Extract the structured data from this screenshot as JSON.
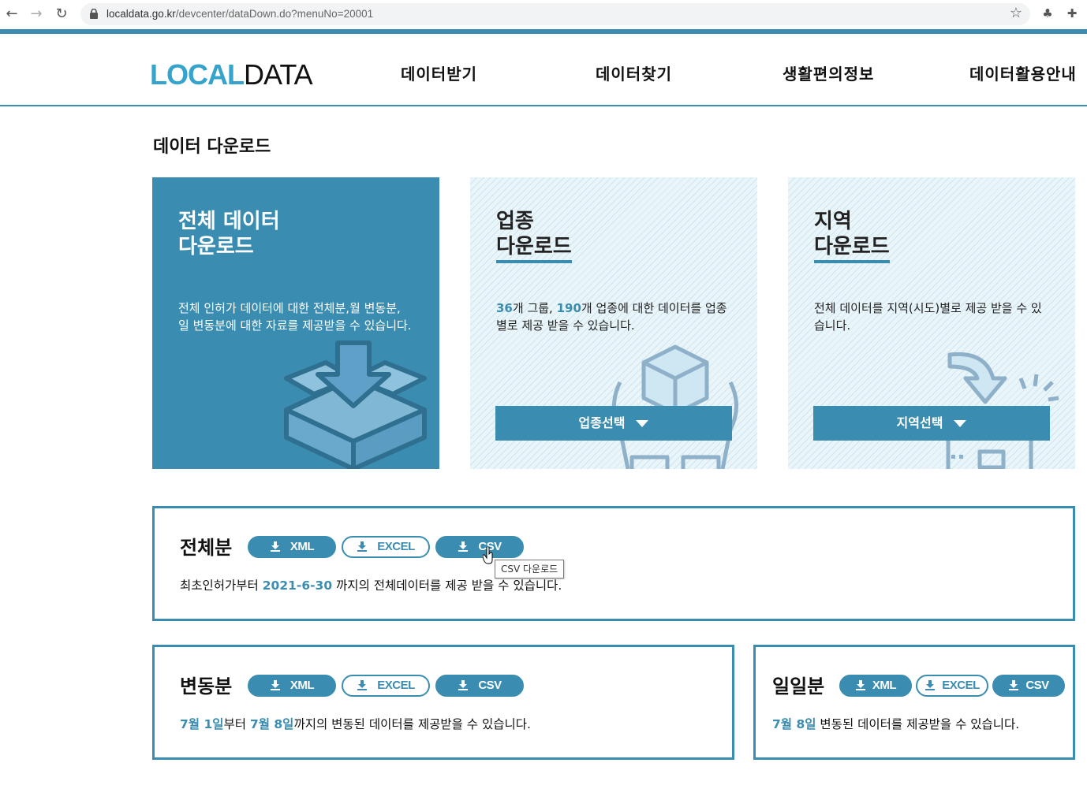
{
  "browser": {
    "url_host": "localdata.go.kr",
    "url_path": "/devcenter/dataDown.do?menuNo=20001"
  },
  "header": {
    "logo_part1": "LOCAL",
    "logo_part2": "DATA",
    "menu": [
      "데이터받기",
      "데이터찾기",
      "생활편의정보",
      "데이터활용안내"
    ]
  },
  "page_title": "데이터 다운로드",
  "cards": {
    "all": {
      "title_line1": "전체 데이터",
      "title_line2": "다운로드",
      "desc": "전체 인허가 데이터에 대한 전체분,월 변동분, 일 변동분에 대한 자료를 제공받을 수 있습니다."
    },
    "industry": {
      "title_line1": "업종",
      "title_line2": "다운로드",
      "group_count": "36",
      "group_text": "개 그룹, ",
      "industry_count": "190",
      "desc_rest": "개 업종에 대한 데이터를 업종별로 제공 받을 수 있습니다.",
      "button": "업종선택"
    },
    "region": {
      "title_line1": "지역",
      "title_line2": "다운로드",
      "desc": "전체 데이터를 지역(시도)별로 제공 받을 수 있습니다.",
      "button": "지역선택"
    }
  },
  "buttons": {
    "xml": "XML",
    "excel": "EXCEL",
    "csv": "CSV"
  },
  "full": {
    "title": "전체분",
    "text_before": "최초인허가부터 ",
    "date": "2021-6-30",
    "text_after": " 까지의 전체데이터를 제공 받을 수 있습니다."
  },
  "tooltip": "CSV 다운로드",
  "change": {
    "title": "변동분",
    "from": "7월 1일",
    "mid": "부터 ",
    "to": "7월 8일",
    "text_after": "까지의 변동된 데이터를 제공받을 수 있습니다."
  },
  "daily": {
    "title": "일일분",
    "date": "7월 8일",
    "text_after": " 변동된 데이터를 제공받을 수 있습니다."
  },
  "colors": {
    "primary": "#3a8db1",
    "logo_accent": "#35a3cc"
  }
}
